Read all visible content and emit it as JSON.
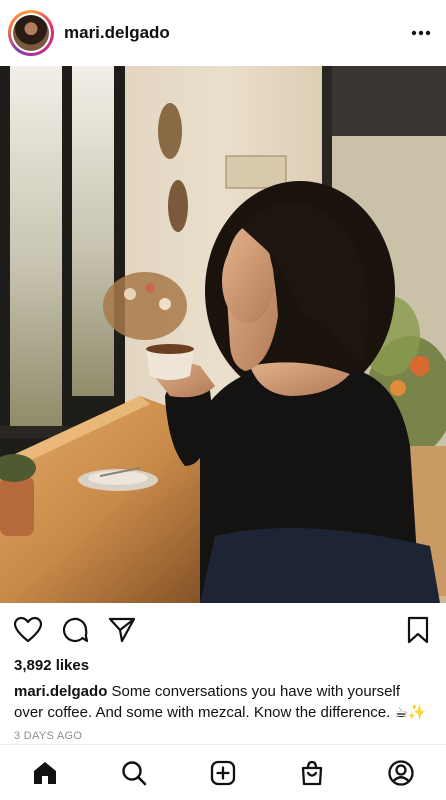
{
  "post": {
    "username": "mari.delgado",
    "likes": "3,892 likes",
    "caption_user": "mari.delgado",
    "caption_text_line1": " Some conversations you have with yourself",
    "caption_text_line2": "over coffee. And some with mezcal. Know the difference. ☕✨",
    "time_ago": "3 DAYS AGO"
  },
  "icons": {
    "more": "more-options-icon",
    "like": "heart-icon",
    "comment": "comment-icon",
    "share": "send-icon",
    "save": "bookmark-icon"
  },
  "nav": [
    "home-icon",
    "search-icon",
    "create-icon",
    "shop-icon",
    "profile-icon"
  ],
  "colors": {
    "text": "#111111",
    "muted": "#8e8e8e",
    "background": "#ffffff"
  }
}
